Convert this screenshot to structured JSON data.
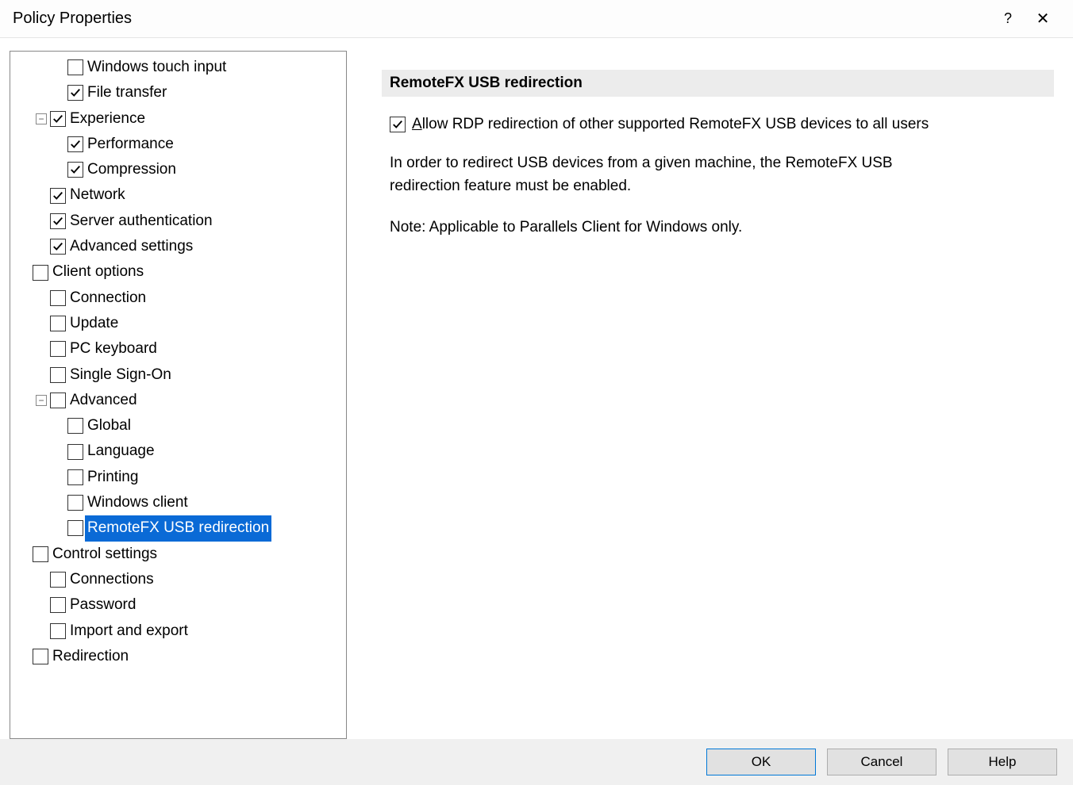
{
  "window": {
    "title": "Policy Properties",
    "help_glyph": "?",
    "close_glyph": "✕"
  },
  "tree": [
    {
      "label": "Windows touch input",
      "level": 2,
      "checked": false,
      "selected": false
    },
    {
      "label": "File transfer",
      "level": 2,
      "checked": true,
      "selected": false
    },
    {
      "label": "Experience",
      "level": 1,
      "checked": true,
      "selected": false,
      "expander": "-"
    },
    {
      "label": "Performance",
      "level": 2,
      "checked": true,
      "selected": false
    },
    {
      "label": "Compression",
      "level": 2,
      "checked": true,
      "selected": false
    },
    {
      "label": "Network",
      "level": 1,
      "checked": true,
      "selected": false
    },
    {
      "label": "Server authentication",
      "level": 1,
      "checked": true,
      "selected": false
    },
    {
      "label": "Advanced settings",
      "level": 1,
      "checked": true,
      "selected": false
    },
    {
      "label": "Client options",
      "level": 0,
      "checked": false,
      "selected": false
    },
    {
      "label": "Connection",
      "level": 1,
      "checked": false,
      "selected": false
    },
    {
      "label": "Update",
      "level": 1,
      "checked": false,
      "selected": false
    },
    {
      "label": "PC keyboard",
      "level": 1,
      "checked": false,
      "selected": false
    },
    {
      "label": "Single Sign-On",
      "level": 1,
      "checked": false,
      "selected": false
    },
    {
      "label": "Advanced",
      "level": 1,
      "checked": false,
      "selected": false,
      "expander": "-"
    },
    {
      "label": "Global",
      "level": 2,
      "checked": false,
      "selected": false
    },
    {
      "label": "Language",
      "level": 2,
      "checked": false,
      "selected": false
    },
    {
      "label": "Printing",
      "level": 2,
      "checked": false,
      "selected": false
    },
    {
      "label": "Windows client",
      "level": 2,
      "checked": false,
      "selected": false
    },
    {
      "label": "RemoteFX USB redirection",
      "level": 2,
      "checked": false,
      "selected": true
    },
    {
      "label": "Control settings",
      "level": 0,
      "checked": false,
      "selected": false
    },
    {
      "label": "Connections",
      "level": 1,
      "checked": false,
      "selected": false
    },
    {
      "label": "Password",
      "level": 1,
      "checked": false,
      "selected": false
    },
    {
      "label": "Import and export",
      "level": 1,
      "checked": false,
      "selected": false
    },
    {
      "label": "Redirection",
      "level": 0,
      "checked": false,
      "selected": false
    }
  ],
  "detail": {
    "heading": "RemoteFX USB redirection",
    "option_checked": true,
    "option_accel": "A",
    "option_label_rest": "llow RDP redirection of other supported RemoteFX USB devices to all users",
    "description": "In order to redirect USB devices from a given machine, the RemoteFX USB redirection feature must be enabled.",
    "note": "Note: Applicable to Parallels Client for Windows only."
  },
  "buttons": {
    "ok": "OK",
    "cancel": "Cancel",
    "help": "Help"
  }
}
